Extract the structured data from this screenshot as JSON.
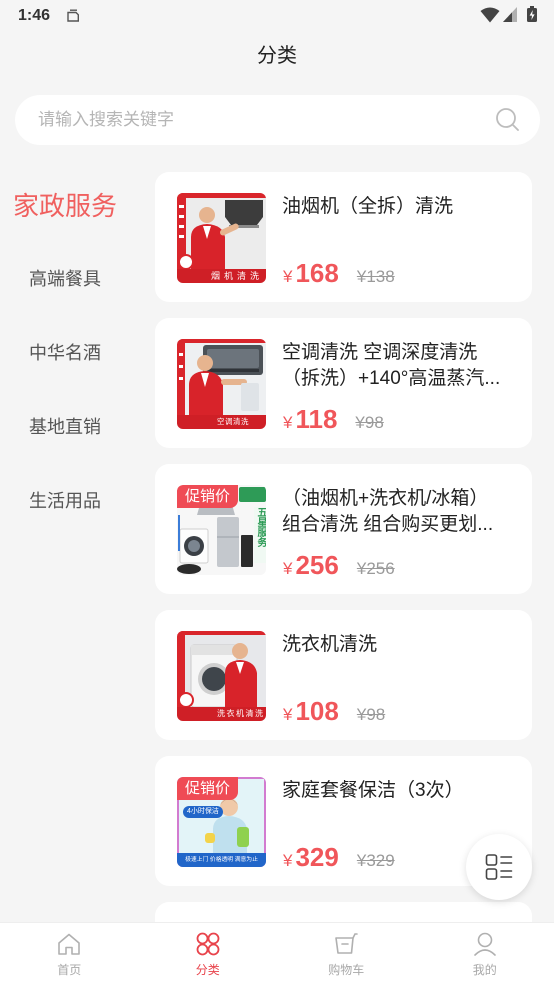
{
  "status_bar": {
    "time": "1:46",
    "icons": [
      "notification-icon",
      "wifi-icon",
      "signal-icon",
      "battery-charging-icon"
    ]
  },
  "header": {
    "title": "分类"
  },
  "search": {
    "placeholder": "请输入搜索关键字",
    "value": "",
    "icon": "search-icon"
  },
  "sidebar": {
    "items": [
      {
        "label": "家政服务",
        "active": true
      },
      {
        "label": "高端餐具",
        "active": false
      },
      {
        "label": "中华名酒",
        "active": false
      },
      {
        "label": "基地直销",
        "active": false
      },
      {
        "label": "生活用品",
        "active": false
      }
    ]
  },
  "currency_symbol": "¥",
  "products": [
    {
      "title_lines": [
        "油烟机（全拆）清洗"
      ],
      "price": "168",
      "original_price": "¥138",
      "image": {
        "captions": [
          "烟机清洗"
        ]
      }
    },
    {
      "title_lines": [
        "空调清洗 空调深度清洗",
        "（拆洗）+140°高温蒸汽..."
      ],
      "price": "118",
      "original_price": "¥98",
      "image": {
        "captions": [
          "空调清洗"
        ]
      }
    },
    {
      "title_lines": [
        "（油烟机+洗衣机/冰箱）",
        "组合清洗 组合购买更划..."
      ],
      "price": "256",
      "original_price": "¥256",
      "badge": "促销价",
      "image": {
        "captions": [
          "五星服务"
        ]
      }
    },
    {
      "title_lines": [
        "洗衣机清洗"
      ],
      "price": "108",
      "original_price": "¥98",
      "image": {
        "captions": [
          "洗衣机清洗"
        ]
      }
    },
    {
      "title_lines": [
        "家庭套餐保洁（3次）"
      ],
      "price": "329",
      "original_price": "¥329",
      "badge": "促销价",
      "image": {
        "captions": [
          "4小时保洁",
          "极速上门 价格透明 满意为止"
        ]
      }
    }
  ],
  "floating_button": {
    "icon": "view-toggle-icon"
  },
  "tabbar": {
    "items": [
      {
        "label": "首页",
        "icon": "home-icon",
        "active": false
      },
      {
        "label": "分类",
        "icon": "category-icon",
        "active": true
      },
      {
        "label": "购物车",
        "icon": "cart-icon",
        "active": false
      },
      {
        "label": "我的",
        "icon": "profile-icon",
        "active": false
      }
    ]
  },
  "colors": {
    "price": "#f0565a",
    "active_category": "#f0605f",
    "active_tab": "#e8434b",
    "badge": "#ef4b55",
    "background": "#f5f5f5"
  }
}
